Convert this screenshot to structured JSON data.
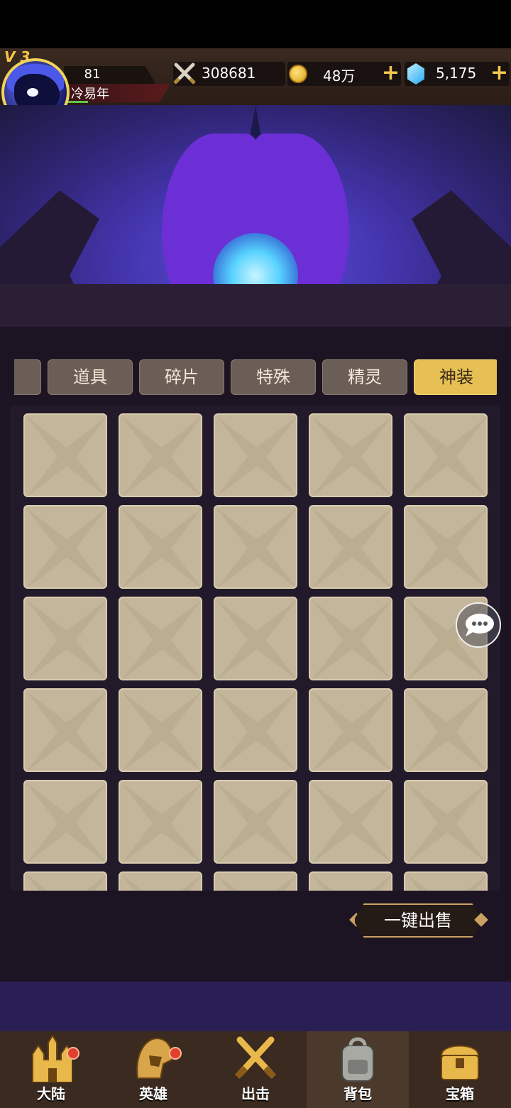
{
  "header": {
    "vip_label": "V 3",
    "level": "81",
    "player_name": "冷易年",
    "power": "308681",
    "gold": "48万",
    "gems": "5,175",
    "plus": "+"
  },
  "tabs": [
    {
      "label": "道具",
      "active": false
    },
    {
      "label": "碎片",
      "active": false
    },
    {
      "label": "特殊",
      "active": false
    },
    {
      "label": "精灵",
      "active": false
    },
    {
      "label": "神装",
      "active": true
    }
  ],
  "inventory": {
    "columns": 5,
    "visible_rows": 6,
    "slot_color": "#c4b69a"
  },
  "actions": {
    "sell_all": "一键出售"
  },
  "bottom_nav": [
    {
      "label": "大陆",
      "icon": "castle-icon",
      "badge": true
    },
    {
      "label": "英雄",
      "icon": "hero-helmet-icon",
      "badge": true
    },
    {
      "label": "出击",
      "icon": "crossed-swords-icon",
      "badge": false
    },
    {
      "label": "背包",
      "icon": "backpack-icon",
      "badge": false,
      "active": true
    },
    {
      "label": "宝箱",
      "icon": "treasure-chest-icon",
      "badge": false
    }
  ],
  "colors": {
    "accent_gold": "#e6c055",
    "badge_red": "#e0402c"
  }
}
